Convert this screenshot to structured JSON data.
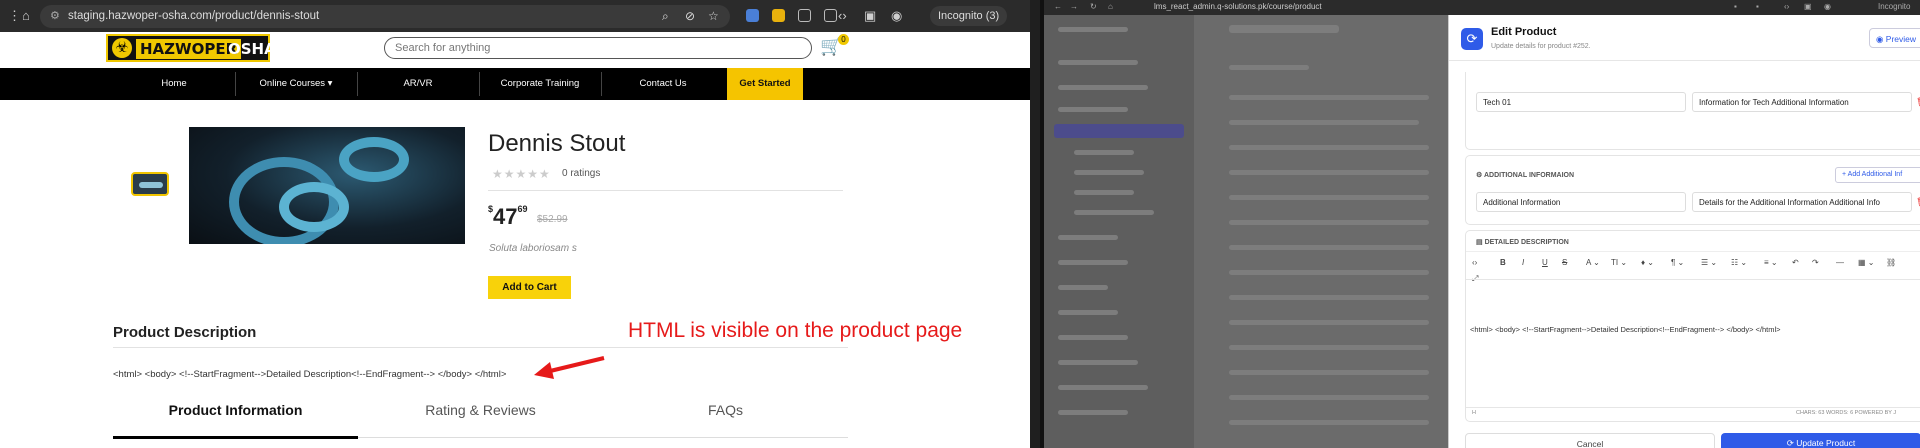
{
  "left_browser": {
    "url": "staging.hazwoper-osha.com/product/dennis-stout",
    "incognito": "Incognito (3)"
  },
  "site": {
    "logo_left": "HAZWOPER",
    "logo_right": "OSHA",
    "search_placeholder": "Search for anything",
    "cart_count": "0",
    "nav": [
      "Home",
      "Online Courses ▾",
      "AR/VR",
      "Corporate Training",
      "Contact Us",
      "Get Started"
    ]
  },
  "product": {
    "title": "Dennis Stout",
    "ratings": "0 ratings",
    "price_symbol": "$",
    "price_main": "47",
    "price_cents": "69",
    "old_price": "$52.99",
    "short_desc": "Soluta laboriosam s",
    "add_to_cart": "Add to Cart",
    "desc_heading": "Product Description",
    "html_text": "<html> <body> <!--StartFragment-->Detailed Description<!--EndFragment--> </body> </html>",
    "tabs": [
      "Product Information",
      "Rating & Reviews",
      "FAQs"
    ]
  },
  "annotation": "HTML is visible on the product page",
  "right_browser": {
    "url": "lms_react_admin.q-solutions.pk/course/product",
    "profile": "Incognito"
  },
  "edit_panel": {
    "title": "Edit Product",
    "subtitle": "Update details for product #252.",
    "preview": "Preview",
    "info_row": {
      "name": "Tech 01",
      "value": "Information for Tech Additional Information"
    },
    "additional_heading": "ADDITIONAL INFORMAION",
    "add_additional": "+ Add Additional Inf",
    "additional_row": {
      "name": "Additional Information",
      "value": "Details for the Additional Information Additional Info"
    },
    "detailed_heading": "DETAILED DESCRIPTION",
    "editor_text": "<html> <body> <!--StartFragment-->Detailed Description<!--EndFragment--> </body> </html>",
    "footer_left": "H",
    "footer_right": "CHARS: 63   WORDS: 6   POWERED BY J",
    "cancel": "Cancel",
    "update": "Update Product"
  },
  "colors": {
    "accent_yellow": "#f5c400",
    "annotation_red": "#e61a1a",
    "admin_blue": "#2f5be8"
  }
}
